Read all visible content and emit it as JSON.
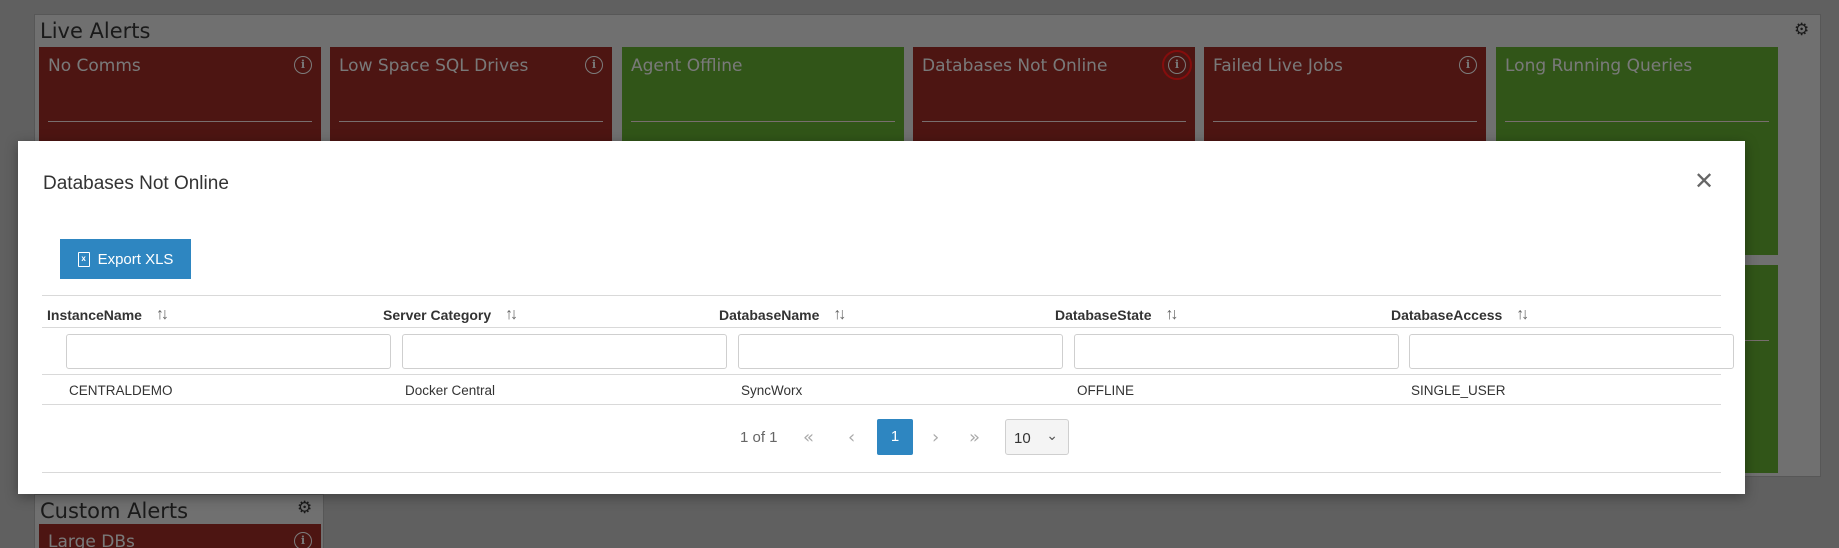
{
  "live_alerts": {
    "title": "Live Alerts",
    "tiles": [
      {
        "title": "No Comms",
        "status": "red",
        "has_info": true
      },
      {
        "title": "Low Space SQL Drives",
        "status": "red",
        "has_info": true
      },
      {
        "title": "Agent Offline",
        "status": "green",
        "has_info": false
      },
      {
        "title": "Databases Not Online",
        "status": "red",
        "has_info": true
      },
      {
        "title": "Failed Live Jobs",
        "status": "red",
        "has_info": true
      },
      {
        "title": "Long Running Queries",
        "status": "green",
        "has_info": false
      }
    ]
  },
  "custom_alerts": {
    "title": "Custom Alerts",
    "tiles": [
      {
        "title": "Large DBs",
        "status": "red",
        "has_info": true
      }
    ]
  },
  "colors": {
    "alert_red": "#952a24",
    "alert_green": "#5ea42f",
    "primary_blue": "#2e86c1"
  },
  "modal": {
    "title": "Databases Not Online",
    "close_icon": "close-icon",
    "export_label": "Export XLS",
    "columns": [
      "InstanceName",
      "Server Category",
      "DatabaseName",
      "DatabaseState",
      "DatabaseAccess"
    ],
    "rows": [
      [
        "CENTRALDEMO",
        "Docker Central",
        "SyncWorx",
        "OFFLINE",
        "SINGLE_USER"
      ]
    ],
    "pager": {
      "info": "1 of 1",
      "first": "«",
      "prev": "‹",
      "current": "1",
      "next": "›",
      "last": "»",
      "page_size": "10"
    }
  }
}
